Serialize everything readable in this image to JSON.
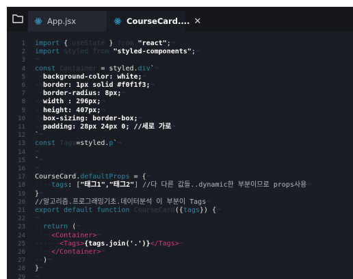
{
  "tabs": [
    {
      "label": "App.jsx",
      "active": false
    },
    {
      "label": "CourseCard....",
      "active": true
    }
  ],
  "icons": {
    "explorer": "folder-icon",
    "react": "react-icon",
    "close": "close-icon"
  },
  "colors": {
    "keyword": "#2f86a0",
    "tag": "#d13b7e",
    "background": "#1b1d24"
  },
  "lines": [
    {
      "n": "1",
      "segs": [
        [
          "import",
          "kw"
        ],
        [
          " { ",
          "txt"
        ],
        [
          "useState",
          "ws"
        ],
        [
          " } ",
          "txt"
        ],
        [
          "from",
          "ws"
        ],
        [
          " ",
          "txt"
        ],
        [
          "\"react\"",
          "str"
        ],
        [
          ";",
          "txt"
        ],
        [
          "¬",
          "ws"
        ]
      ]
    },
    {
      "n": "2",
      "segs": [
        [
          "import",
          "kw"
        ],
        [
          " ",
          "txt"
        ],
        [
          "styled",
          "ws"
        ],
        [
          " ",
          "txt"
        ],
        [
          "from",
          "ws"
        ],
        [
          " ",
          "txt"
        ],
        [
          "\"styled-components\"",
          "str"
        ],
        [
          ";",
          "txt"
        ],
        [
          "¬",
          "ws"
        ]
      ]
    },
    {
      "n": "3",
      "segs": [
        [
          "¬",
          "ws"
        ]
      ]
    },
    {
      "n": "4",
      "segs": [
        [
          "const",
          "kw"
        ],
        [
          " ",
          "txt"
        ],
        [
          "Container",
          "ws"
        ],
        [
          " = styled.",
          "txt"
        ],
        [
          "div",
          "kw"
        ],
        [
          "`",
          "txt"
        ],
        [
          "¬",
          "ws"
        ]
      ]
    },
    {
      "n": "5",
      "segs": [
        [
          "··",
          "ws"
        ],
        [
          "background-color: white;",
          "str"
        ],
        [
          "¬",
          "ws"
        ]
      ]
    },
    {
      "n": "6",
      "segs": [
        [
          "··",
          "ws"
        ],
        [
          "border: 1px solid #f0f1f3;",
          "str"
        ],
        [
          "¬",
          "ws"
        ]
      ]
    },
    {
      "n": "7",
      "segs": [
        [
          "··",
          "ws"
        ],
        [
          "border-radius: 8px;",
          "str"
        ],
        [
          "¬",
          "ws"
        ]
      ]
    },
    {
      "n": "8",
      "segs": [
        [
          "··",
          "ws"
        ],
        [
          "width : 296px;",
          "str"
        ],
        [
          "¬",
          "ws"
        ]
      ]
    },
    {
      "n": "9",
      "segs": [
        [
          "··",
          "ws"
        ],
        [
          "height: 407px;",
          "str"
        ],
        [
          "¬",
          "ws"
        ]
      ]
    },
    {
      "n": "10",
      "segs": [
        [
          "··",
          "ws"
        ],
        [
          "box-sizing: border-box;",
          "str"
        ],
        [
          "¬",
          "ws"
        ]
      ]
    },
    {
      "n": "11",
      "segs": [
        [
          "··",
          "ws"
        ],
        [
          "padding: 28px 24px 0; //세로 가로",
          "str"
        ],
        [
          "¬",
          "ws"
        ]
      ]
    },
    {
      "n": "12",
      "segs": [
        [
          "`",
          "txt"
        ],
        [
          "¬",
          "ws"
        ]
      ]
    },
    {
      "n": "13",
      "segs": [
        [
          "const",
          "kw"
        ],
        [
          " ",
          "txt"
        ],
        [
          "Tags",
          "ws"
        ],
        [
          "=styled.",
          "txt"
        ],
        [
          "p",
          "kw"
        ],
        [
          "`",
          "txt"
        ],
        [
          "¬",
          "ws"
        ]
      ]
    },
    {
      "n": "14",
      "segs": [
        [
          "¬",
          "ws"
        ]
      ]
    },
    {
      "n": "15",
      "segs": [
        [
          "`",
          "txt"
        ],
        [
          "¬",
          "ws"
        ]
      ]
    },
    {
      "n": "16",
      "segs": [
        [
          "¬",
          "ws"
        ]
      ]
    },
    {
      "n": "17",
      "segs": [
        [
          "CourseCard.",
          "txt"
        ],
        [
          "defaultProps",
          "kw"
        ],
        [
          " = {",
          "txt"
        ],
        [
          "¬",
          "ws"
        ]
      ]
    },
    {
      "n": "18",
      "segs": [
        [
          "····",
          "ws"
        ],
        [
          "tags",
          "kw"
        ],
        [
          ": [",
          "txt"
        ],
        [
          "\"태그1\",\"태그2\"",
          "str"
        ],
        [
          "] //다 다른 값들..dynamic한 부분이므로 props사용",
          "cm"
        ],
        [
          "¬",
          "ws"
        ]
      ]
    },
    {
      "n": "19",
      "segs": [
        [
          "}",
          "txt"
        ],
        [
          "¬",
          "ws"
        ]
      ]
    },
    {
      "n": "20",
      "segs": [
        [
          "//알고리즘.프로그래밍기초.데이터분석 이 부분이 Tags",
          "cm"
        ],
        [
          "¬",
          "ws"
        ]
      ]
    },
    {
      "n": "21",
      "segs": [
        [
          "export",
          "kw"
        ],
        [
          " ",
          "txt"
        ],
        [
          "default",
          "kw"
        ],
        [
          " ",
          "txt"
        ],
        [
          "function",
          "kw"
        ],
        [
          " ",
          "txt"
        ],
        [
          "CourseCard",
          "ws"
        ],
        [
          "({",
          "txt"
        ],
        [
          "tags",
          "kw"
        ],
        [
          "}) {",
          "txt"
        ],
        [
          "¬",
          "ws"
        ]
      ]
    },
    {
      "n": "22",
      "segs": [
        [
          "¬",
          "ws"
        ]
      ]
    },
    {
      "n": "23",
      "segs": [
        [
          "··",
          "ws"
        ],
        [
          "return",
          "kw"
        ],
        [
          " (",
          "txt"
        ],
        [
          "¬",
          "ws"
        ]
      ]
    },
    {
      "n": "24",
      "segs": [
        [
          "····",
          "ws"
        ],
        [
          "<Container>",
          "tag"
        ],
        [
          "¬",
          "ws"
        ]
      ]
    },
    {
      "n": "25",
      "segs": [
        [
          "······",
          "ws"
        ],
        [
          "<Tags>",
          "tag"
        ],
        [
          "{tags.join('.')}",
          "str"
        ],
        [
          "</Tags>",
          "tag"
        ],
        [
          "¬",
          "ws"
        ]
      ]
    },
    {
      "n": "26",
      "segs": [
        [
          "····",
          "ws"
        ],
        [
          "</Container>",
          "tag"
        ],
        [
          "¬",
          "ws"
        ]
      ]
    },
    {
      "n": "27",
      "segs": [
        [
          "··",
          "ws"
        ],
        [
          ")",
          "txt"
        ],
        [
          "¬",
          "ws"
        ]
      ]
    },
    {
      "n": "28",
      "segs": [
        [
          "}",
          "txt"
        ],
        [
          "¬",
          "ws"
        ]
      ]
    },
    {
      "n": "29",
      "segs": [
        [
          "¬",
          "ws"
        ]
      ]
    }
  ]
}
